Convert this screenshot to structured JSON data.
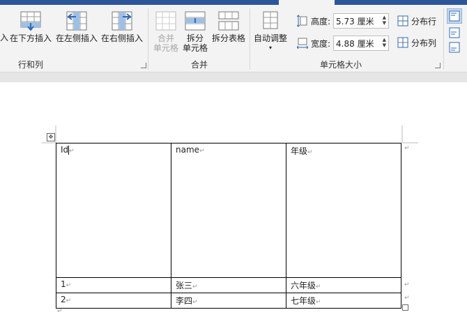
{
  "ribbon": {
    "insert_partial": "入",
    "insert_below": "在下方插入",
    "insert_left": "在左侧插入",
    "insert_right": "在右侧插入",
    "group_rows_cols": "行和列",
    "merge_cells_line1": "合并",
    "merge_cells_line2": "单元格",
    "split_cells_line1": "拆分",
    "split_cells_line2": "单元格",
    "split_table": "拆分表格",
    "group_merge": "合并",
    "autofit": "自动调整",
    "height_label": "高度:",
    "height_value": "5.73 厘米",
    "width_label": "宽度:",
    "width_value": "4.88 厘米",
    "distribute_rows": "分布行",
    "distribute_cols": "分布列",
    "group_cell_size": "单元格大小"
  },
  "table": {
    "header": [
      "Id",
      "name",
      "年级"
    ],
    "rows": [
      [
        "1",
        "张三",
        "六年级"
      ],
      [
        "2",
        "李四",
        "七年级"
      ]
    ]
  },
  "para_mark": "↵",
  "colors": {
    "accent": "#2b579a",
    "ribbon_bg": "#f3f3f3",
    "canvas_bg": "#e6e6e6",
    "icon_blue": "#2e6ab3"
  }
}
